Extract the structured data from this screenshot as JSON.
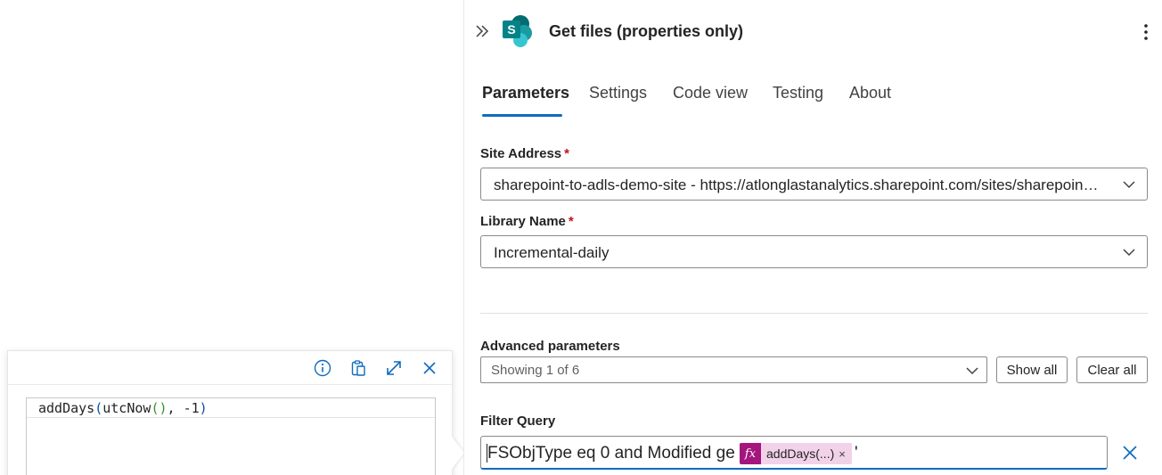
{
  "expression_popup": {
    "tools": [
      {
        "icon": "info-icon"
      },
      {
        "icon": "clipboard-paste-icon"
      },
      {
        "icon": "expand-icon"
      },
      {
        "icon": "close-icon"
      }
    ],
    "expression": {
      "fn_outer": "addDays",
      "open1": "(",
      "fn_inner": "utcNow",
      "inner_parens": "()",
      "separator": ", ",
      "arg": "-1",
      "close1": ")"
    }
  },
  "panel": {
    "title": "Get files (properties only)",
    "tabs": [
      {
        "label": "Parameters",
        "active": true
      },
      {
        "label": "Settings",
        "active": false
      },
      {
        "label": "Code view",
        "active": false
      },
      {
        "label": "Testing",
        "active": false
      },
      {
        "label": "About",
        "active": false
      }
    ],
    "site_address": {
      "label": "Site Address",
      "required_mark": "*",
      "value": "sharepoint-to-adls-demo-site - https://atlonglastanalytics.sharepoint.com/sites/sharepoint-to-adls-demo-site"
    },
    "library_name": {
      "label": "Library Name",
      "required_mark": "*",
      "value": "Incremental-daily"
    },
    "advanced": {
      "label": "Advanced parameters",
      "showing": "Showing 1 of 6",
      "show_all": "Show all",
      "clear_all": "Clear all"
    },
    "filter_query": {
      "label": "Filter Query",
      "text_before": "FSObjType eq 0 and Modified ge '",
      "token_icon": "fx",
      "token_label": "addDays(...)",
      "token_remove": "×",
      "text_after": "'"
    }
  },
  "colors": {
    "accent": "#0f6cbd",
    "token_bg": "#f2d2e9",
    "token_icon_bg": "#a4167e",
    "required": "#c50f1f",
    "sharepoint_teal": "#038387"
  }
}
